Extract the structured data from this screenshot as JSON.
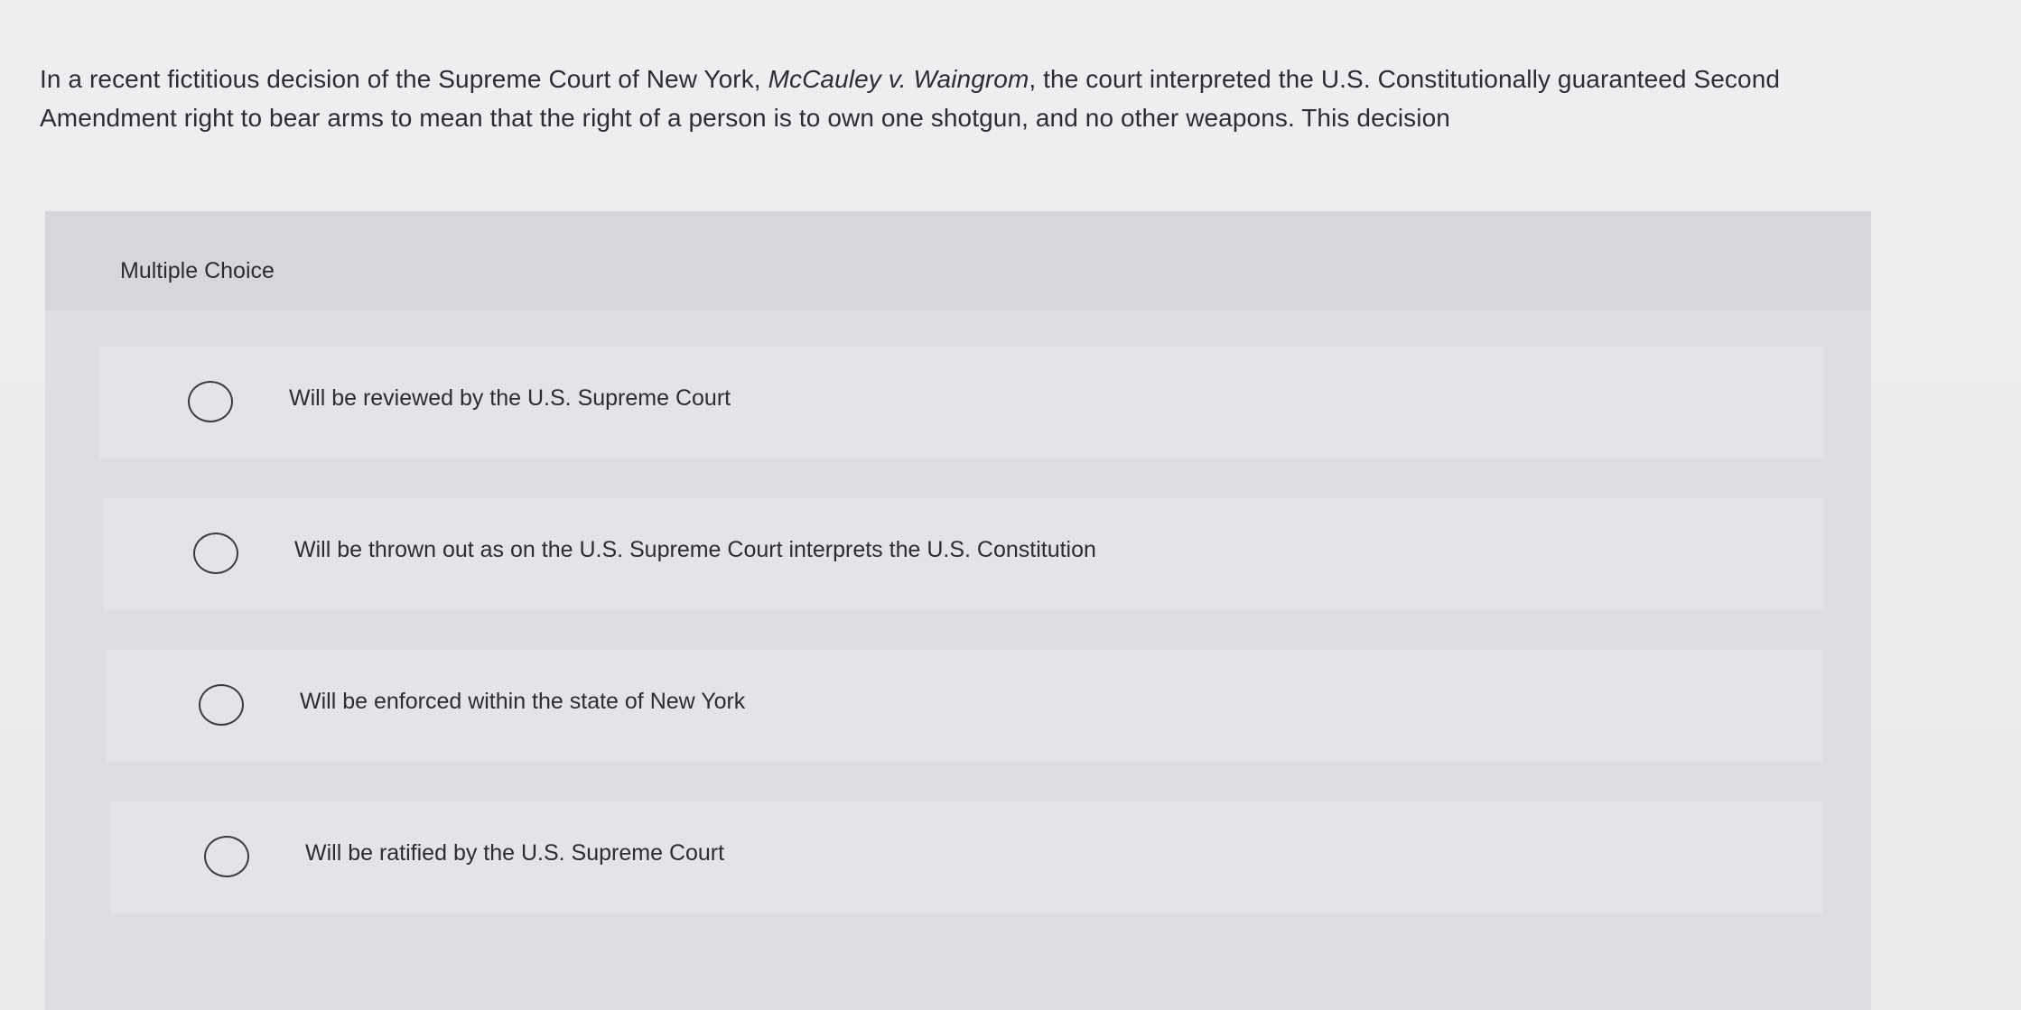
{
  "question": {
    "text_before": "In a recent fictitious decision of the Supreme Court of New York, ",
    "case_name": "McCauley v. Waingrom",
    "text_after": ", the court interpreted the U.S. Constitutionally guaranteed Second Amendment right to bear arms to mean that the right of a person is to own one shotgun, and no other weapons. This decision"
  },
  "multiple_choice": {
    "label": "Multiple Choice",
    "options": [
      {
        "label": "Will be reviewed by the U.S. Supreme Court"
      },
      {
        "label": "Will be thrown out as on the U.S. Supreme Court interprets the U.S. Constitution"
      },
      {
        "label": "Will be enforced within the state of New York"
      },
      {
        "label": "Will be ratified by the U.S. Supreme Court"
      }
    ]
  }
}
